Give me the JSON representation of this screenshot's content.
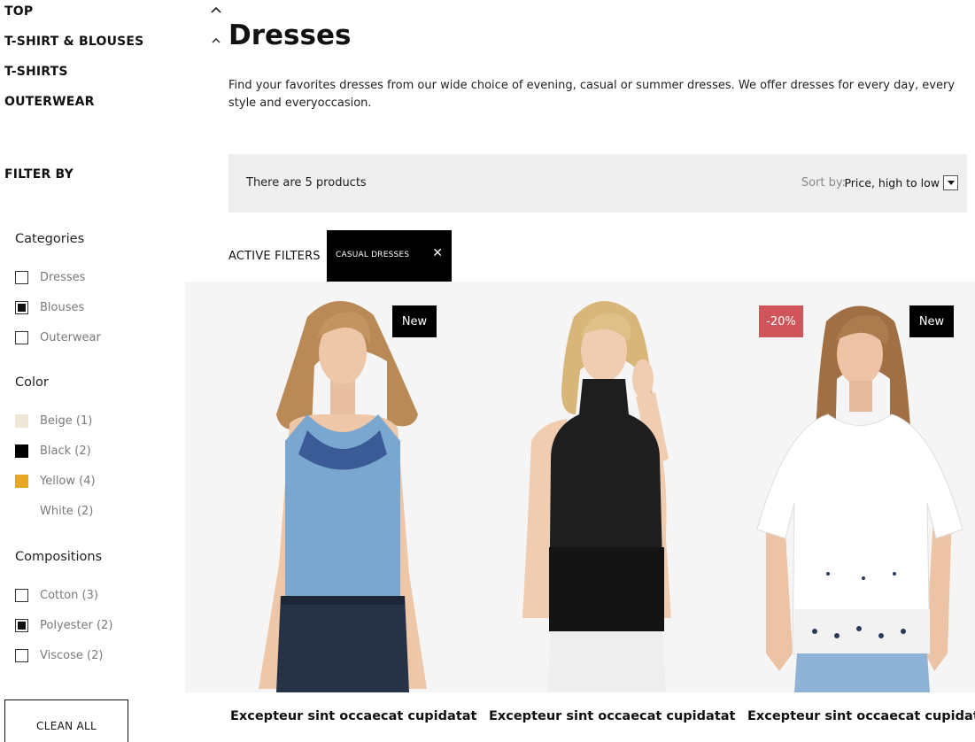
{
  "nav": {
    "items": [
      {
        "label": "TOP"
      },
      {
        "label": "T-SHIRT & BLOUSES"
      },
      {
        "label": "T-SHIRTS"
      },
      {
        "label": "OUTERWEAR"
      }
    ]
  },
  "filters": {
    "title": "FILTER BY",
    "categories": {
      "title": "Categories",
      "options": [
        {
          "label": "Dresses",
          "checked": false
        },
        {
          "label": "Blouses",
          "checked": true
        },
        {
          "label": "Outerwear",
          "checked": false
        }
      ]
    },
    "color": {
      "title": "Color",
      "options": [
        {
          "label": "Beige (1)",
          "swatch": "#f0e6d8"
        },
        {
          "label": "Black (2)",
          "swatch": "#000000"
        },
        {
          "label": "Yellow (4)",
          "swatch": "#e8a823"
        },
        {
          "label": "White (2)",
          "swatch": "#ffffff"
        }
      ]
    },
    "compositions": {
      "title": "Compositions",
      "options": [
        {
          "label": "Cotton (3)",
          "checked": false
        },
        {
          "label": "Polyester (2)",
          "checked": true
        },
        {
          "label": "Viscose (2)",
          "checked": false
        }
      ]
    },
    "clean_all": "CLEAN ALL"
  },
  "main": {
    "title": "Dresses",
    "description": "Find your favorites dresses from our wide choice of evening, casual or summer dresses. We offer dresses for every day, every style and everyoccasion.",
    "count_text": "There are 5 products",
    "sort_label": "Sort by:",
    "sort_value": "Price, high to low",
    "active_filters_label": "ACTIVE FILTERS",
    "active_filter_chip": "CASUAL DRESSES",
    "chip_close": "✕"
  },
  "products": [
    {
      "name": "Excepteur sint occaecat cupidatat",
      "badges": [
        "New"
      ],
      "top_color": "#7aa7cf"
    },
    {
      "name": "Excepteur sint occaecat cupidatat",
      "badges": [],
      "top_color": "#1e1e1e"
    },
    {
      "name": "Excepteur sint occaecat cupidatat",
      "badges": [
        "-20%",
        "New"
      ],
      "top_color": "#ffffff"
    }
  ],
  "colors": {
    "sale_badge": "#d0555a",
    "toolbar_bg": "#efefef",
    "grid_bg": "#f5f5f5"
  }
}
